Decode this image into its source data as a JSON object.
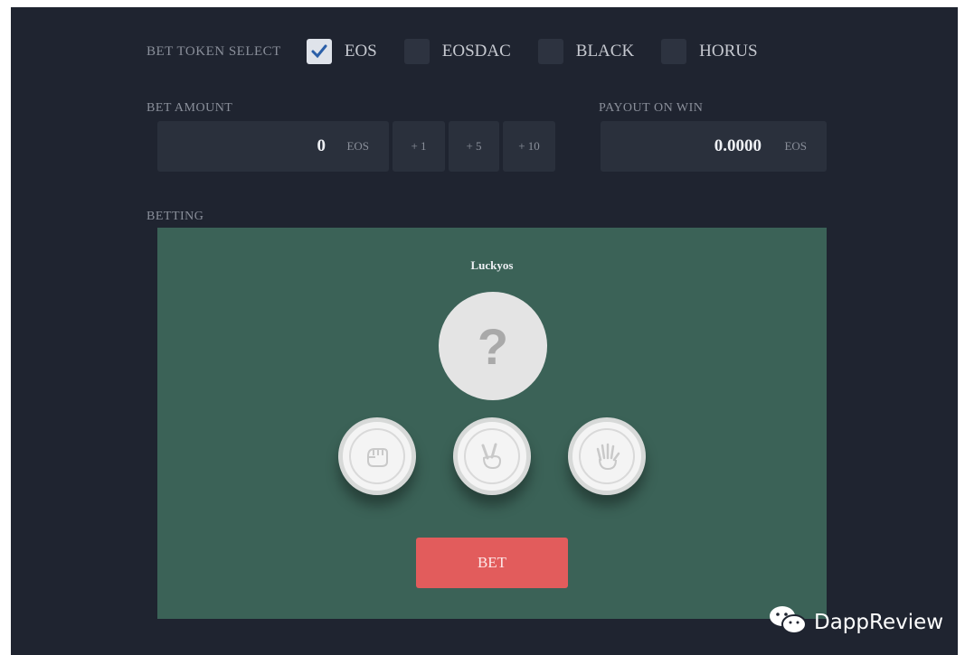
{
  "token_select": {
    "label": "BET TOKEN SELECT",
    "tokens": [
      {
        "name": "EOS",
        "checked": true
      },
      {
        "name": "EOSDAC",
        "checked": false
      },
      {
        "name": "BLACK",
        "checked": false
      },
      {
        "name": "HORUS",
        "checked": false
      }
    ]
  },
  "bet_amount": {
    "label": "BET AMOUNT",
    "value": "0",
    "unit": "EOS",
    "increments": [
      "+ 1",
      "+ 5",
      "+ 10"
    ]
  },
  "payout": {
    "label": "PAYOUT ON WIN",
    "value": "0.0000",
    "unit": "EOS"
  },
  "betting": {
    "label": "BETTING",
    "opponent_name": "Luckyos",
    "mystery_symbol": "?",
    "choices": [
      "rock-icon",
      "scissors-icon",
      "paper-icon"
    ],
    "bet_button": "BET"
  },
  "watermark": "DappReview",
  "colors": {
    "background": "#1f2430",
    "field": "#2a303c",
    "betting_area": "#3b6257",
    "bet_button": "#e25c5c"
  }
}
